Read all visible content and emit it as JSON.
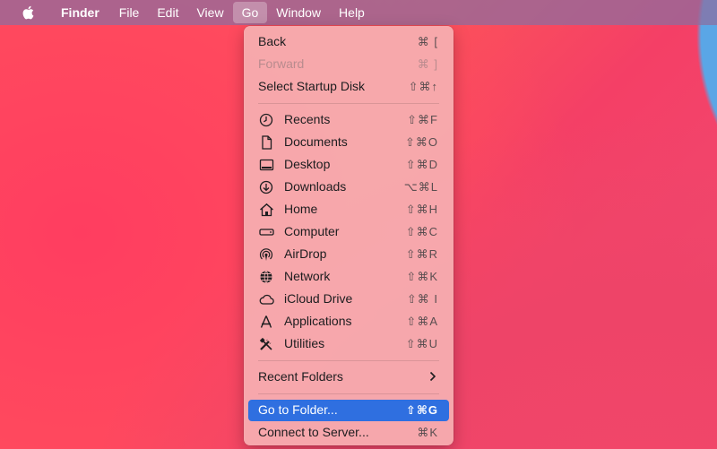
{
  "menubar": {
    "apple_icon": "apple-icon",
    "items": [
      "Finder",
      "File",
      "Edit",
      "View",
      "Go",
      "Window",
      "Help"
    ]
  },
  "go_menu": {
    "back": {
      "label": "Back",
      "shortcut": "⌘ ["
    },
    "forward": {
      "label": "Forward",
      "shortcut": "⌘ ]"
    },
    "startup": {
      "label": "Select Startup Disk",
      "shortcut": "⇧⌘↑"
    },
    "recents": {
      "label": "Recents",
      "shortcut": "⇧⌘F",
      "icon": "clock-icon"
    },
    "documents": {
      "label": "Documents",
      "shortcut": "⇧⌘O",
      "icon": "document-icon"
    },
    "desktop": {
      "label": "Desktop",
      "shortcut": "⇧⌘D",
      "icon": "desktop-icon"
    },
    "downloads": {
      "label": "Downloads",
      "shortcut": "⌥⌘L",
      "icon": "download-icon"
    },
    "home": {
      "label": "Home",
      "shortcut": "⇧⌘H",
      "icon": "home-icon"
    },
    "computer": {
      "label": "Computer",
      "shortcut": "⇧⌘C",
      "icon": "computer-icon"
    },
    "airdrop": {
      "label": "AirDrop",
      "shortcut": "⇧⌘R",
      "icon": "airdrop-icon"
    },
    "network": {
      "label": "Network",
      "shortcut": "⇧⌘K",
      "icon": "globe-icon"
    },
    "icloud": {
      "label": "iCloud Drive",
      "shortcut": "⇧⌘ I",
      "icon": "cloud-icon"
    },
    "applications": {
      "label": "Applications",
      "shortcut": "⇧⌘A",
      "icon": "applications-icon"
    },
    "utilities": {
      "label": "Utilities",
      "shortcut": "⇧⌘U",
      "icon": "tools-icon"
    },
    "recent_folders": {
      "label": "Recent Folders"
    },
    "go_to_folder": {
      "label": "Go to Folder...",
      "shortcut": "⇧⌘G"
    },
    "connect": {
      "label": "Connect to Server...",
      "shortcut": "⌘K"
    }
  },
  "colors": {
    "selection": "#2f6fe0",
    "menubar": "#8c6ea0"
  }
}
